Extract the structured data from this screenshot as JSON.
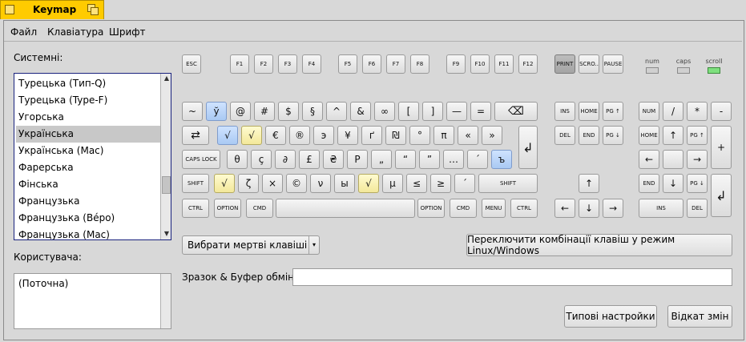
{
  "window": {
    "title": "Keymap"
  },
  "menu": {
    "file": "Файл",
    "keyboard": "Клавіатура",
    "font": "Шрифт"
  },
  "system": {
    "label": "Системні:",
    "items": [
      "Турецька (Тип-Q)",
      "Турецька (Type-F)",
      "Угорська",
      "Українська",
      "Українська (Mac)",
      "Фарерська",
      "Фінська",
      "Французька",
      "Французька (Вéро)",
      "Французька (Mac)"
    ],
    "selected": "Українська"
  },
  "user": {
    "label": "Користувача:",
    "items": [
      "(Поточна)"
    ]
  },
  "keys": {
    "esc": "ESC",
    "f": [
      "F1",
      "F2",
      "F3",
      "F4",
      "F5",
      "F6",
      "F7",
      "F8",
      "F9",
      "F10",
      "F11",
      "F12"
    ],
    "print": "PRINT",
    "scroll": "SCRO..",
    "pause": "PAUSE",
    "row1": [
      "~",
      "ў",
      "@",
      "#",
      "$",
      "§",
      "^",
      "&",
      "∞",
      "[",
      "]",
      "—",
      "="
    ],
    "backspace": "⌫",
    "row2": [
      "√",
      "√",
      "€",
      "®",
      "э",
      "¥",
      "ґ",
      "₪",
      "°",
      "π",
      "«",
      "»"
    ],
    "tab": "⇄",
    "enter": "↲",
    "capslock": "CAPS LOCK",
    "row3": [
      "θ",
      "ç",
      "∂",
      "£",
      "₴",
      "Р",
      "„",
      "“",
      "”",
      "…",
      "´",
      "ъ"
    ],
    "shift": "SHIFT",
    "row4": [
      "√",
      "ζ",
      "×",
      "©",
      "ν",
      "ы",
      "√",
      "μ",
      "≤",
      "≥",
      "´"
    ],
    "ctrl": "CTRL",
    "option": "OPTION",
    "cmd": "CMD",
    "menu": "MENU",
    "ins": "INS",
    "home": "HOME",
    "pgup": "PG ↑",
    "del": "DEL",
    "end": "END",
    "pgdn": "PG ↓",
    "up": "↑",
    "down": "↓",
    "left": "←",
    "right": "→",
    "num": "NUM",
    "slash": "/",
    "star": "*",
    "minus": "-",
    "plus": "+"
  },
  "leds": {
    "num": "num",
    "caps": "caps",
    "scroll": "scroll"
  },
  "dead_keys": "Вибрати мертві клавіші",
  "switch_button": "Переключити комбінації клавіш у режим Linux/Windows",
  "sample_label": "Зразок & Буфер обміну:",
  "sample_value": "",
  "defaults_button": "Типові настройки",
  "revert_button": "Відкат змін"
}
